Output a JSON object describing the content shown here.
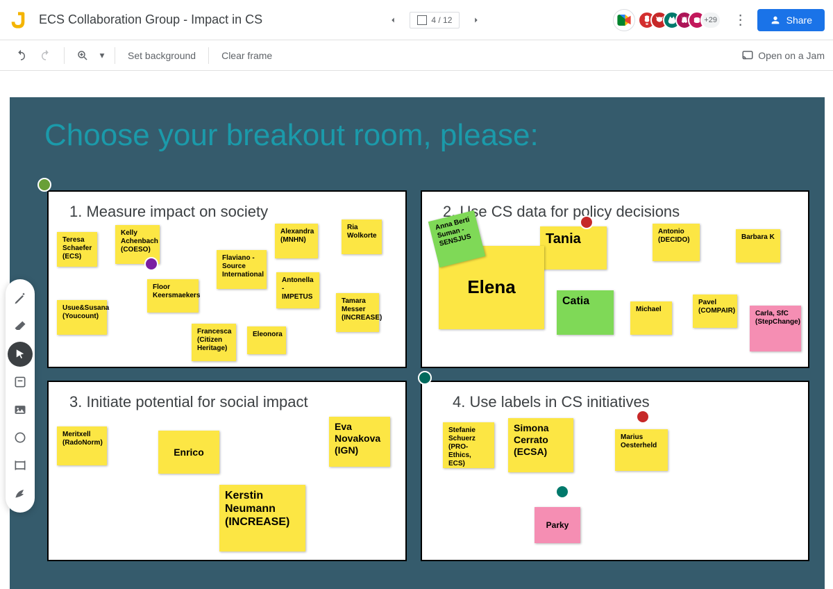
{
  "doc_title": "ECS Collaboration Group - Impact in CS",
  "frame": "4 / 12",
  "avatar_more": "+29",
  "share_label": "Share",
  "toolbar": {
    "set_bg": "Set background",
    "clear_frame": "Clear frame",
    "open_jam": "Open on a Jam"
  },
  "slide_title": "Choose your breakout room, please:",
  "rooms": {
    "r1": {
      "title": "1. Measure impact on society"
    },
    "r2": {
      "title": "2. Use CS data for policy decisions"
    },
    "r3": {
      "title": "3. Initiate potential for social impact"
    },
    "r4": {
      "title": "4. Use labels in CS initiatives"
    }
  },
  "notes": {
    "r1": {
      "teresa": "Teresa Schaefer (ECS)",
      "kelly": "Kelly Achenbach (COESO)",
      "alexandra": "Alexandra (MNHN)",
      "ria": "Ria Wolkorte",
      "floor": "Floor Keersmaekers",
      "flaviano": "Flaviano - Source International",
      "antonella": "Antonella - IMPETUS",
      "usue": "Usue&Susana (Youcount)",
      "francesca": "Francesca (Citizen Heritage)",
      "eleonora": "Eleonora",
      "tamara": "Tamara Messer (INCREASE)"
    },
    "r2": {
      "anna": "Anna Berti Suman - SENSJUS",
      "tania": "Tania",
      "antonio": "Antonio (DECIDO)",
      "barbara": "Barbara K",
      "elena": "Elena",
      "catia": "Catia",
      "michael": "Michael",
      "pavel": "Pavel (COMPAIR)",
      "carla": "Carla, SfC (StepChange)"
    },
    "r3": {
      "meritxell": "Meritxell (RadoNorm)",
      "enrico": "Enrico",
      "kerstin": "Kerstin Neumann (INCREASE)",
      "eva": "Eva Novakova (IGN)"
    },
    "r4": {
      "stefanie": "Stefanie Schuerz (PRO-Ethics, ECS)",
      "simona": "Simona Cerrato (ECSA)",
      "marius": "Marius Oesterheld",
      "parky": "Parky"
    }
  }
}
